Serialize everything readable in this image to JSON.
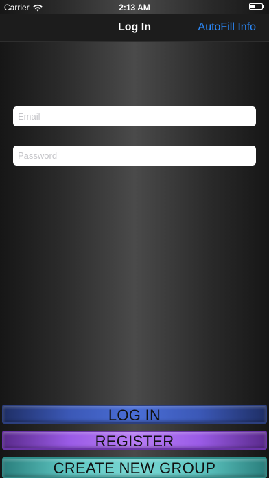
{
  "status_bar": {
    "carrier": "Carrier",
    "time": "2:13 AM",
    "wifi_icon": "wifi-icon",
    "battery_icon": "battery-icon"
  },
  "nav": {
    "title": "Log In",
    "right_action": "AutoFill Info",
    "right_action_color": "#2c8cff"
  },
  "form": {
    "email": {
      "placeholder": "Email",
      "value": ""
    },
    "password": {
      "placeholder": "Password",
      "value": ""
    }
  },
  "buttons": {
    "login": "LOG IN",
    "register": "REGISTER",
    "create_group": "CREATE NEW GROUP"
  },
  "colors": {
    "login": "#4a6ed6",
    "register": "#b77df4",
    "create_group": "#7ad7d3"
  }
}
